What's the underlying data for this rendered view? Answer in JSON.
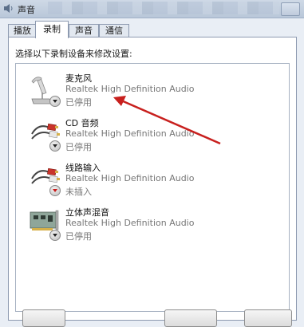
{
  "window": {
    "title": "声音"
  },
  "tabs": [
    {
      "label": "播放"
    },
    {
      "label": "录制"
    },
    {
      "label": "声音"
    },
    {
      "label": "通信"
    }
  ],
  "panel": {
    "instruction": "选择以下录制设备来修改设置:"
  },
  "devices": [
    {
      "name": "麦克风",
      "driver": "Realtek High Definition Audio",
      "status": "已停用",
      "icon": "microphone-icon"
    },
    {
      "name": "CD 音频",
      "driver": "Realtek High Definition Audio",
      "status": "已停用",
      "icon": "rca-cable-icon"
    },
    {
      "name": "线路输入",
      "driver": "Realtek High Definition Audio",
      "status": "未插入",
      "icon": "rca-cable-icon"
    },
    {
      "name": "立体声混音",
      "driver": "Realtek High Definition Audio",
      "status": "已停用",
      "icon": "sound-card-icon"
    }
  ],
  "colors": {
    "annotation_arrow": "#c8201e",
    "selected_tab": "#ffffff"
  }
}
